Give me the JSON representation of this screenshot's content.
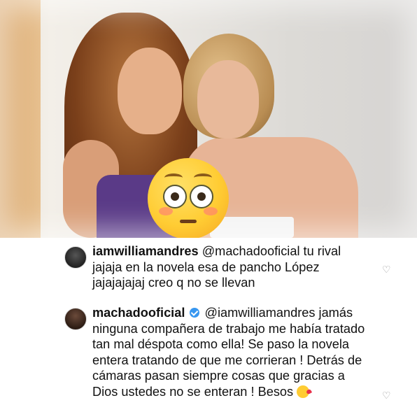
{
  "comments": [
    {
      "username": "iamwilliamandres",
      "text": "@machadooficial tu rival jajaja en la novela esa de pancho López jajajajajaj creo q no se llevan",
      "verified": false
    },
    {
      "username": "machadooficial",
      "verified": true,
      "text": "@iamwilliamandres jamás ninguna compañera de trabajo me había tratado tan mal déspota como ella! Se paso la novela entera tratando de que me corrieran ! Detrás  de cámaras pasan siempre cosas que gracias a Dios ustedes no se enteran ! Besos",
      "emoji": "kissing-face-with-heart-emoji"
    }
  ],
  "icons": {
    "like": "heart-outline-icon",
    "overlay_emoji": "flushed-face-emoji"
  },
  "colors": {
    "verified_badge": "#3897f0",
    "text": "#111111"
  }
}
